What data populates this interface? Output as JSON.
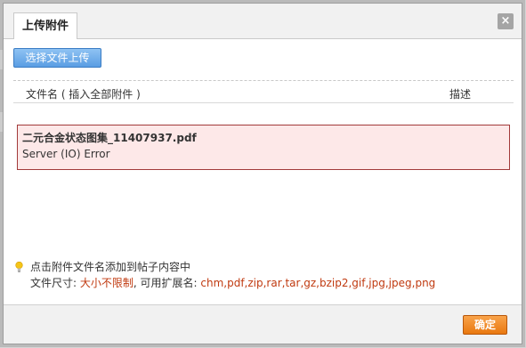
{
  "dialog": {
    "tab_title": "上传附件",
    "close_symbol": "×"
  },
  "toolbar": {
    "upload_label": "选择文件上传"
  },
  "table": {
    "col_filename": "文件名 ( 插入全部附件 )",
    "col_description": "描述"
  },
  "error": {
    "filename": "二元合金状态图集_11407937.pdf",
    "message": "Server (IO) Error"
  },
  "hints": {
    "line1": "点击附件文件名添加到帖子内容中",
    "size_label": "文件尺寸: ",
    "size_value": "大小不限制",
    "ext_label": ", 可用扩展名: ",
    "ext_value": "chm,pdf,zip,rar,tar,gz,bzip2,gif,jpg,jpeg,png"
  },
  "footer": {
    "ok_label": "确定"
  },
  "colors": {
    "upload_button": "#5a9de3",
    "ok_button": "#e97810",
    "error_border": "#a23a3a",
    "error_background": "#fde8e8",
    "highlight_text": "#c03a10"
  },
  "icons": {
    "close": "close-icon",
    "hint": "lightbulb-icon"
  }
}
